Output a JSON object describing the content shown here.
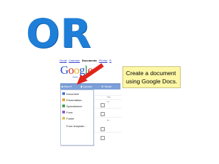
{
  "heading": "OR",
  "callout": {
    "text": "Create a document using Google Docs."
  },
  "google_nav": {
    "links": [
      "Gmail",
      "Calendar",
      "Documents",
      "Photos",
      "R"
    ],
    "current": "Documents"
  },
  "logo": {
    "letters": [
      "G",
      "o",
      "o",
      "g",
      "l",
      "e"
    ],
    "sub": "Docs"
  },
  "toolbar": {
    "new_label": "New",
    "upload_label": "Upload",
    "share_label": "Share"
  },
  "new_menu": [
    {
      "label": "Document",
      "icon": "document-icon",
      "color": "#4a79d3"
    },
    {
      "label": "Presentation",
      "icon": "presentation-icon",
      "color": "#e8a23a"
    },
    {
      "label": "Spreadsheet",
      "icon": "spreadsheet-icon",
      "color": "#3fa34d"
    },
    {
      "label": "Form",
      "icon": "form-icon",
      "color": "#8e5bc7"
    },
    {
      "label": "Folder",
      "icon": "folder-icon",
      "color": "#e2c35a"
    },
    {
      "label": "From template...",
      "icon": "",
      "color": ""
    }
  ],
  "right_column": {
    "snippets": [
      "Title",
      "Th",
      "Oc"
    ]
  },
  "colors": {
    "heading": "#1f7fd8",
    "arrow": "#e0241b",
    "callout_bg": "#fdf7a6",
    "toolbar_bg": "#7da0d8"
  }
}
